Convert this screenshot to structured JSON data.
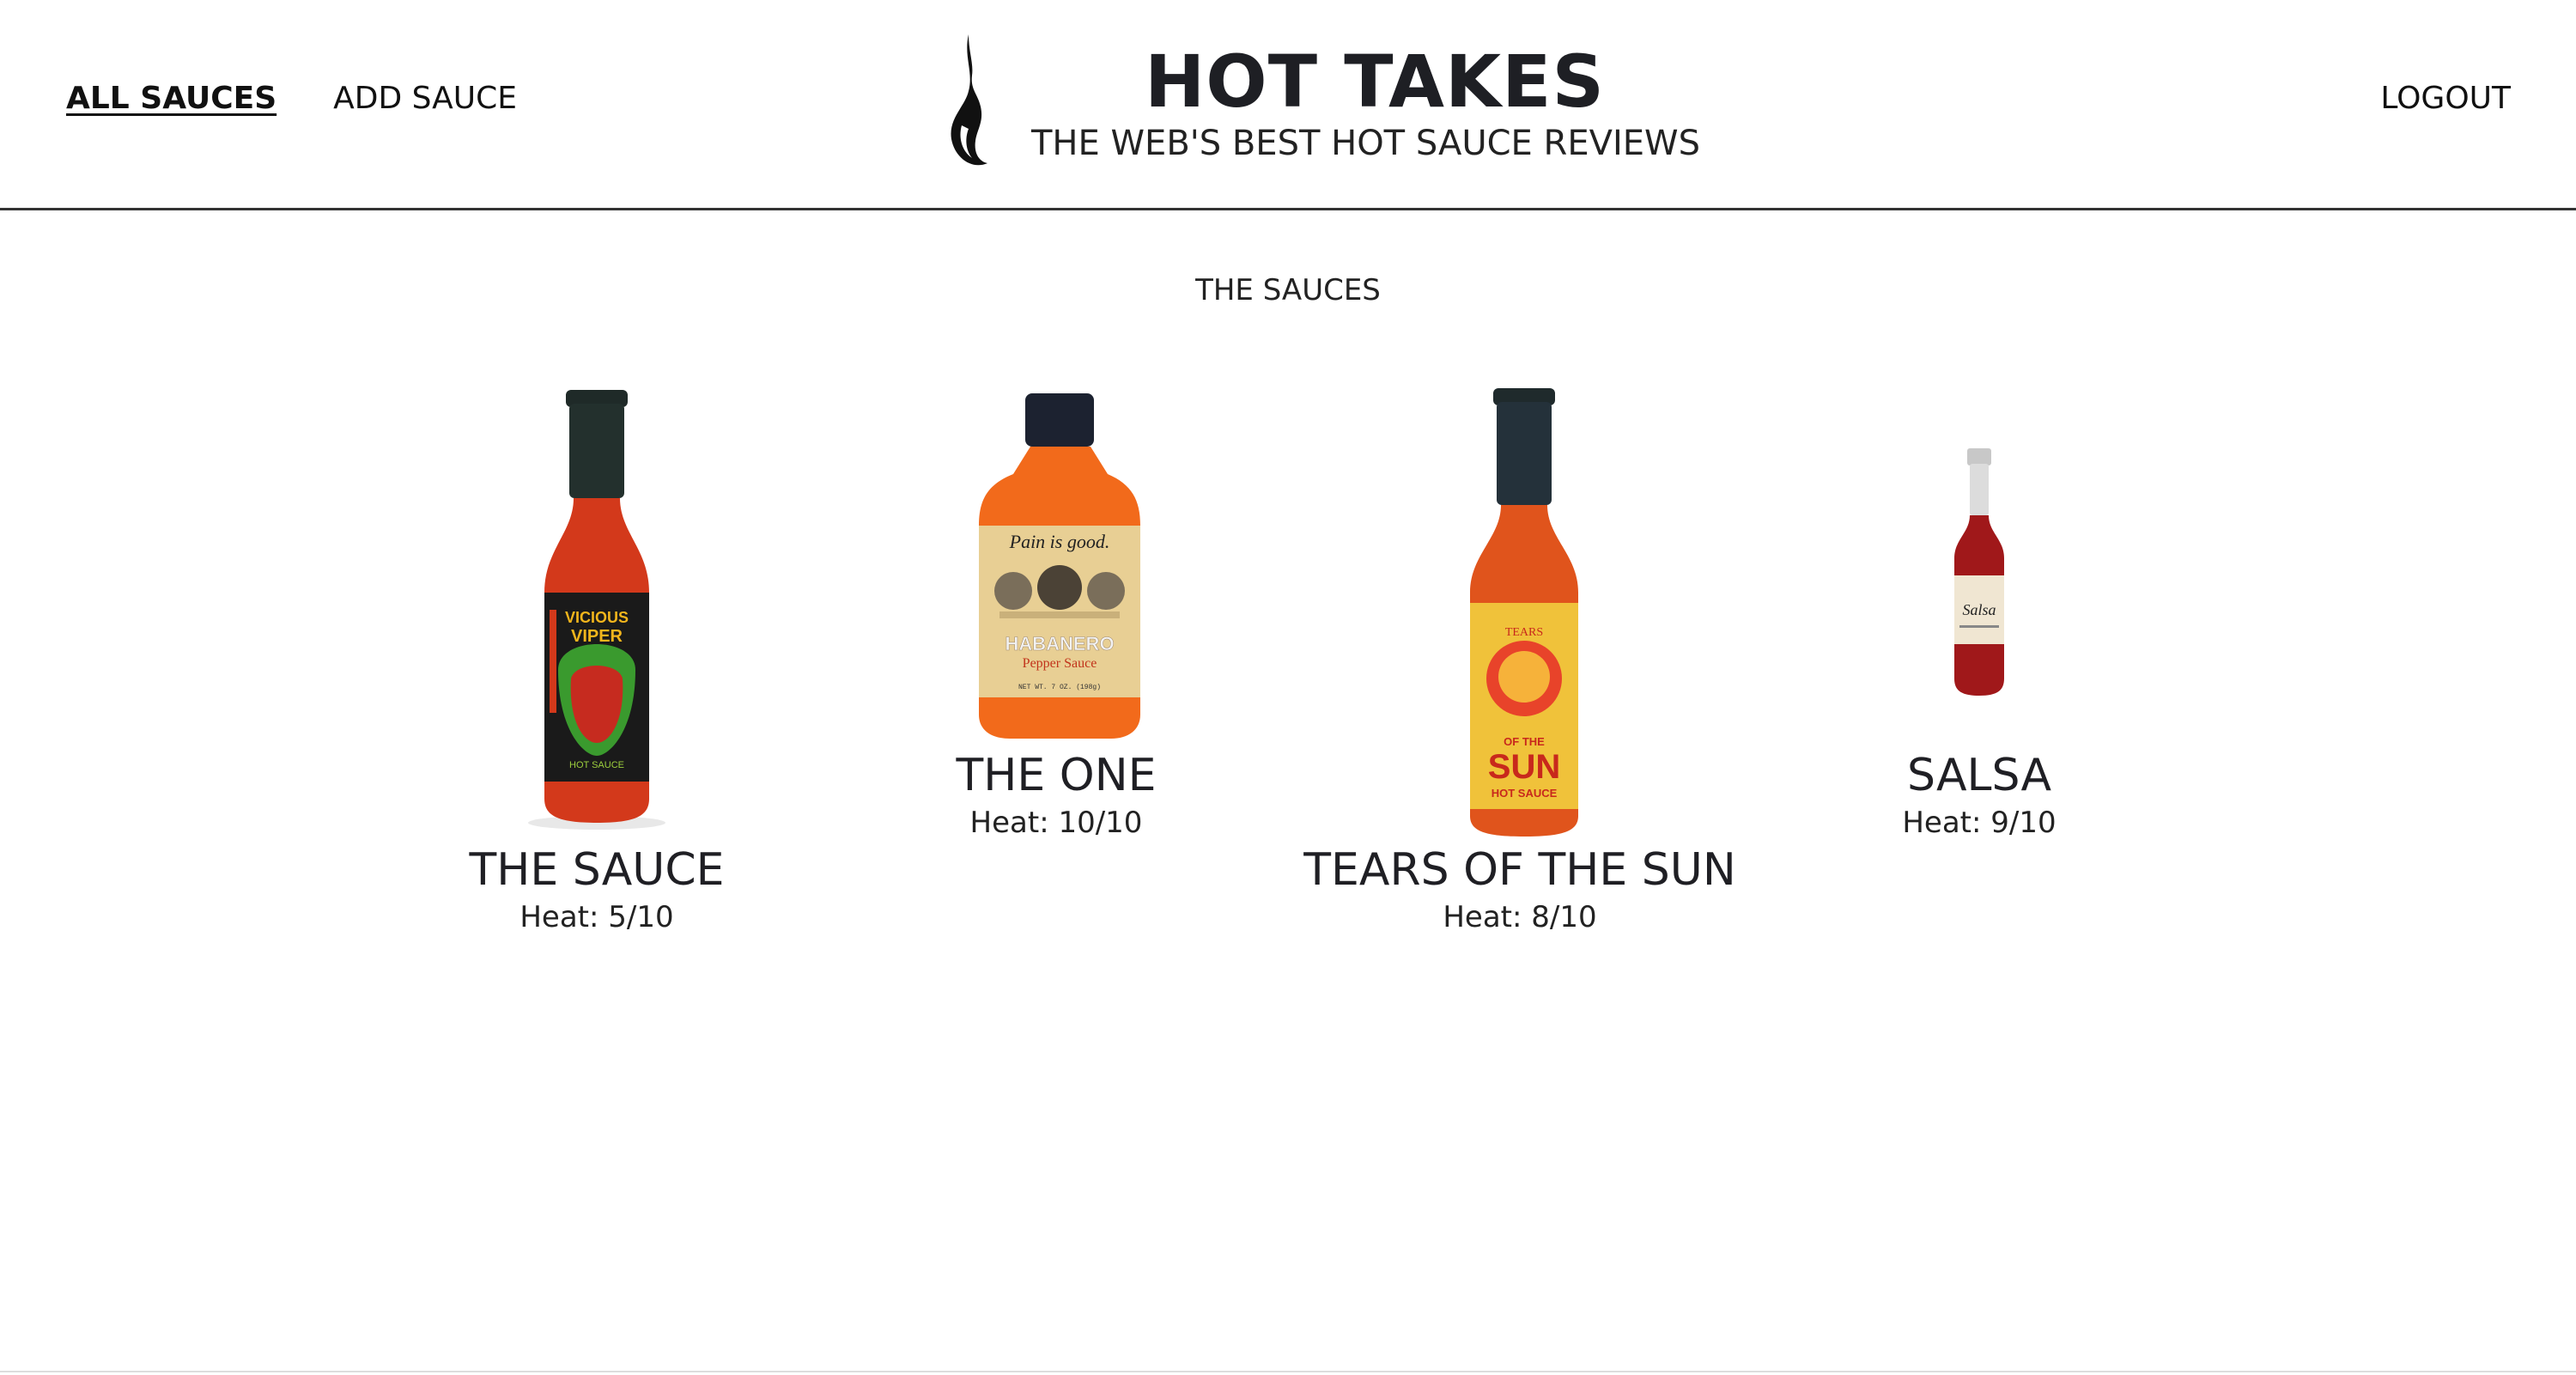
{
  "nav": {
    "all_sauces": "ALL SAUCES",
    "add_sauce": "ADD SAUCE",
    "logout": "LOGOUT"
  },
  "brand": {
    "title": "HOT TAKES",
    "subtitle": "THE WEB'S BEST HOT SAUCE REVIEWS"
  },
  "main": {
    "section_title": "THE SAUCES",
    "sauces": [
      {
        "name": "THE SAUCE",
        "heat": "Heat: 5/10",
        "label_text": "VICIOUS VIPER",
        "label_sub": "HOT SAUCE"
      },
      {
        "name": "THE ONE",
        "heat": "Heat: 10/10",
        "label_text": "Pain is good.",
        "label_sub": "HABANERO"
      },
      {
        "name": "TEARS OF THE SUN",
        "heat": "Heat: 8/10",
        "label_text": "SUN",
        "label_sub": "HOT SAUCE"
      },
      {
        "name": "SALSA",
        "heat": "Heat: 9/10",
        "label_text": "Salsa",
        "label_sub": ""
      }
    ]
  },
  "colors": {
    "accent": "#1e1f24",
    "divider": "#333333"
  }
}
